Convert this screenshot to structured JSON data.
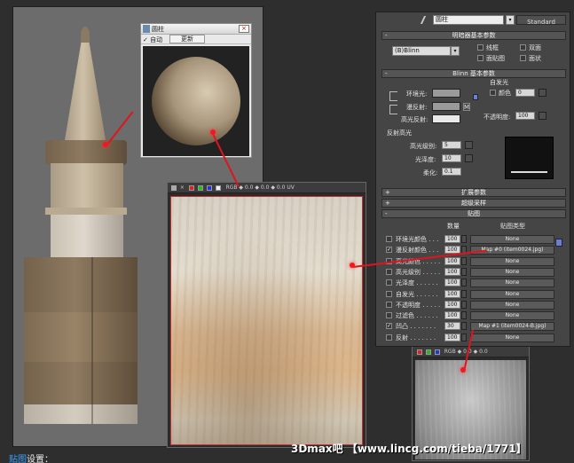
{
  "preview_window": {
    "title": "圆柱",
    "auto_label": "✓ 自动",
    "update_label": "更新",
    "close": "×"
  },
  "tex_toolbar": {
    "label": "RGB  ◆ 0.0  ◆ 0.0  ◆ 0.0  UV"
  },
  "tex_toolbar2": {
    "label": "RGB  ◆ 0.0  ◆ 0.0"
  },
  "panel": {
    "material_name": "圆柱",
    "material_type": "Standard",
    "shader_rollout": "明暗器基本参数",
    "shader_type": "(B)Blinn",
    "wire": "线框",
    "two_sided": "双面",
    "face_map": "面贴图",
    "faceted": "面状",
    "blinn_rollout": "Blinn 基本参数",
    "self_illum": "自发光",
    "color_label": "颜色",
    "color_value": "0",
    "ambient": "环境光:",
    "diffuse": "漫反射:",
    "specular": "高光反射:",
    "opacity": "不透明度:",
    "opacity_value": "100",
    "spec_highlights": "反射高光",
    "spec_level": "高光级别:",
    "spec_level_value": "5",
    "glossiness": "光泽度:",
    "glossiness_value": "10",
    "soften": "柔化:",
    "soften_value": "0.1",
    "extended_rollout": "扩展参数",
    "supersampling_rollout": "超级采样",
    "maps_rollout": "贴图",
    "col_amount": "数量",
    "col_map_type": "贴图类型",
    "m_label": "M",
    "plus": "+",
    "minus": "-"
  },
  "maps": [
    {
      "name": "环境光颜色 . . .",
      "checked": false,
      "amount": "100",
      "map": "None"
    },
    {
      "name": "漫反射颜色 . . .",
      "checked": true,
      "amount": "100",
      "map": "Map #0 (item0024.jpg)"
    },
    {
      "name": "高光颜色 . . . . .",
      "checked": false,
      "amount": "100",
      "map": "None"
    },
    {
      "name": "高光级别 . . . . .",
      "checked": false,
      "amount": "100",
      "map": "None"
    },
    {
      "name": "光泽度 . . . . . .",
      "checked": false,
      "amount": "100",
      "map": "None"
    },
    {
      "name": "自发光 . . . . . .",
      "checked": false,
      "amount": "100",
      "map": "None"
    },
    {
      "name": "不透明度 . . . . .",
      "checked": false,
      "amount": "100",
      "map": "None"
    },
    {
      "name": "过滤色 . . . . . .",
      "checked": false,
      "amount": "100",
      "map": "None"
    },
    {
      "name": "凹凸 . . . . . . .",
      "checked": true,
      "amount": "30",
      "map": "Map #1 (item0024-B.jpg)"
    },
    {
      "name": "反射 . . . . . . .",
      "checked": false,
      "amount": "100",
      "map": "None"
    }
  ],
  "footer": {
    "caption_link": "贴图",
    "caption_rest": "设置：",
    "watermark": "3Dmax吧 【www.lincg.com/tieba/1771】"
  },
  "colors": {
    "accent_red": "#e0141c",
    "link_blue": "#3aa0ff"
  }
}
